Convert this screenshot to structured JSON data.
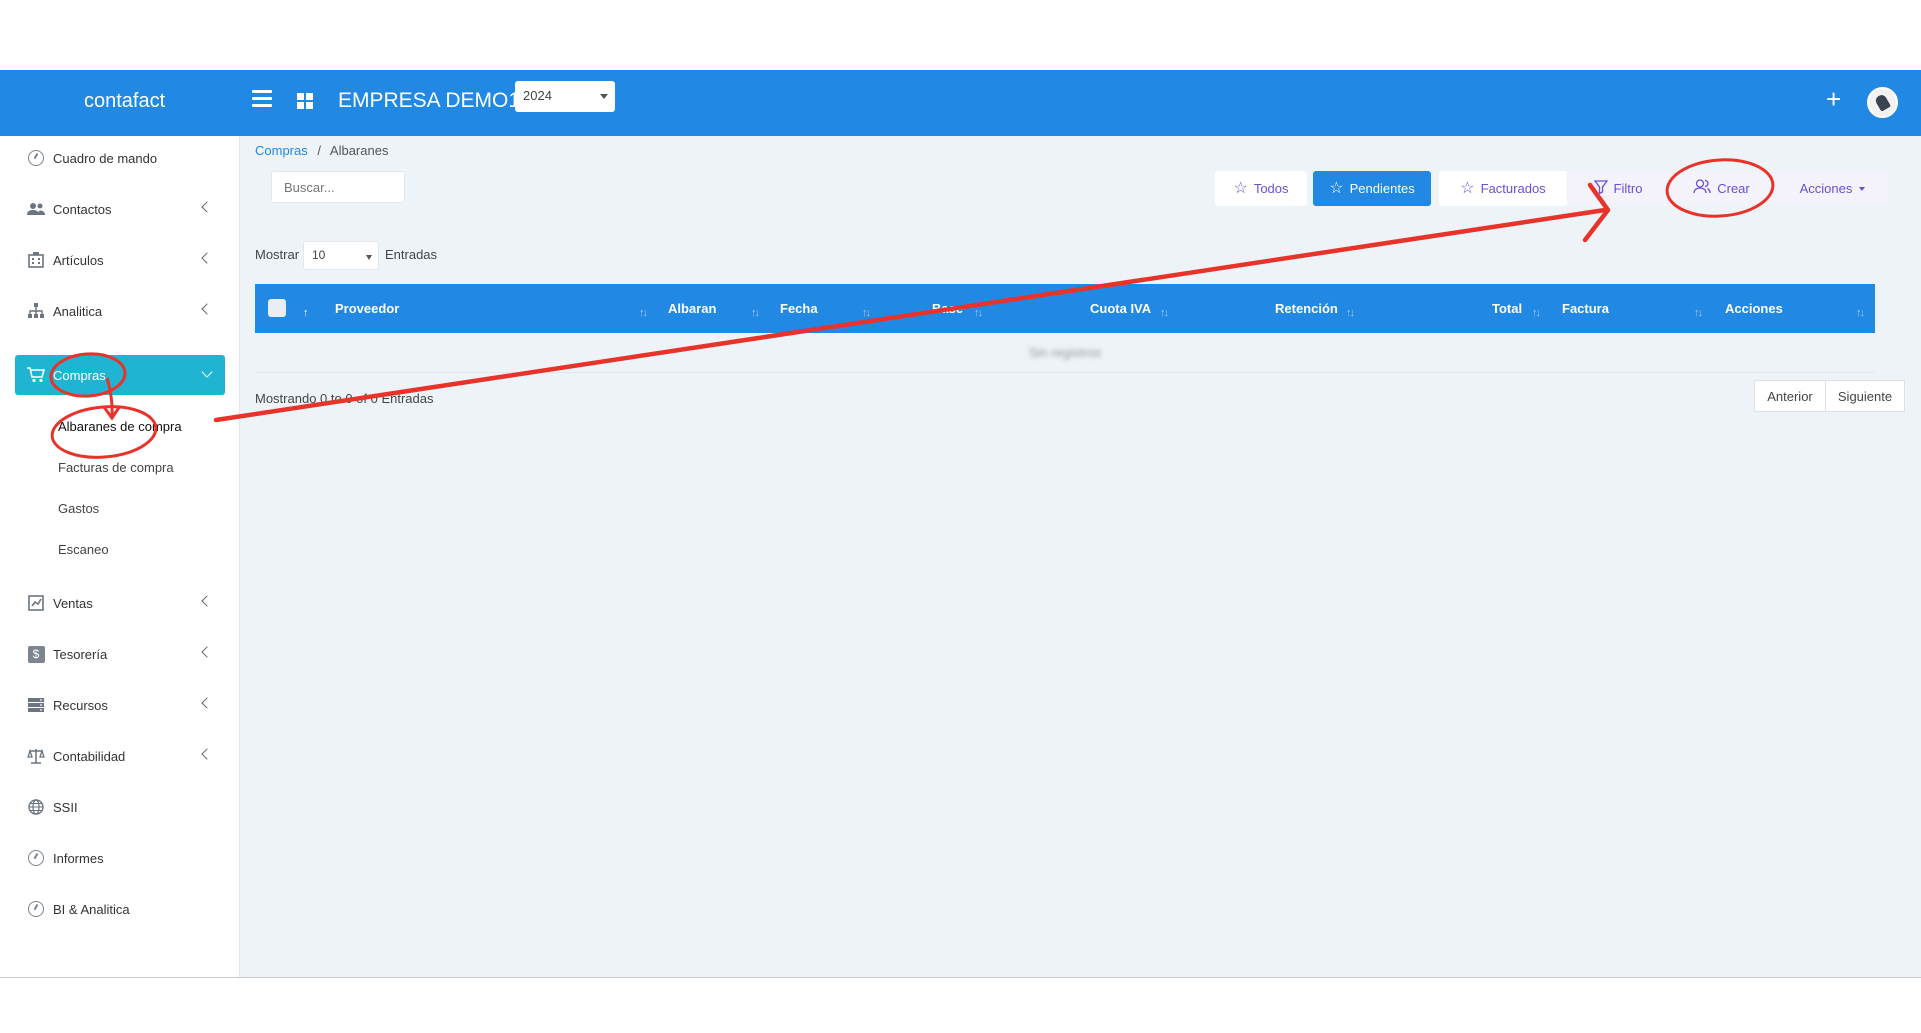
{
  "topbar": {
    "brand": "contafact",
    "company": "EMPRESA DEMO1",
    "year": "2024"
  },
  "sidebar": {
    "items": [
      {
        "label": "Cuadro de mando",
        "icon": "dashboard-icon"
      },
      {
        "label": "Contactos",
        "icon": "users-icon"
      },
      {
        "label": "Artículos",
        "icon": "building-icon"
      },
      {
        "label": "Analitica",
        "icon": "sitemap-icon"
      },
      {
        "label": "Compras",
        "icon": "cart-icon"
      },
      {
        "label": "Ventas",
        "icon": "chart-icon"
      },
      {
        "label": "Tesorería",
        "icon": "dollar-icon"
      },
      {
        "label": "Recursos",
        "icon": "server-icon"
      },
      {
        "label": "Contabilidad",
        "icon": "balance-icon"
      },
      {
        "label": "SSII",
        "icon": "globe-icon"
      },
      {
        "label": "Informes",
        "icon": "dashboard-icon"
      },
      {
        "label": "BI & Analitica",
        "icon": "dashboard-icon"
      }
    ],
    "compras_sub": [
      "Albaranes de compra",
      "Facturas de compra",
      "Gastos",
      "Escaneo"
    ]
  },
  "breadcrumb": {
    "parent": "Compras",
    "separator": "/",
    "current": "Albaranes"
  },
  "search": {
    "placeholder": "Buscar..."
  },
  "toolbar": {
    "todos": "Todos",
    "pendientes": "Pendientes",
    "facturados": "Facturados",
    "filtro": "Filtro",
    "crear": "Crear",
    "acciones": "Acciones"
  },
  "length": {
    "show": "Mostrar",
    "value": "10",
    "entries": "Entradas"
  },
  "table": {
    "columns": [
      "Proveedor",
      "Albaran",
      "Fecha",
      "Base",
      "Cuota IVA",
      "Retención",
      "Total",
      "Factura",
      "Acciones"
    ],
    "empty": "Sin registros"
  },
  "footer": {
    "info": "Mostrando 0 to 0 of 0 Entradas",
    "prev": "Anterior",
    "next": "Siguiente"
  },
  "colors": {
    "primary": "#2188e3",
    "active_menu": "#1fb5d2",
    "accent": "#6a4fd4",
    "annotation": "#e8332a"
  }
}
